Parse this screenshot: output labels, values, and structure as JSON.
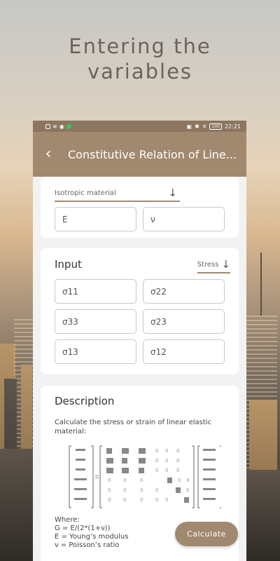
{
  "headline": {
    "line1": "Entering the",
    "line2": "variables"
  },
  "status_bar": {
    "time": "22:21",
    "battery": "100"
  },
  "appbar": {
    "title": "Constitutive Relation of Line..."
  },
  "material": {
    "selected": "Isotropic material",
    "fields": [
      {
        "placeholder": "E"
      },
      {
        "placeholder": "ν"
      }
    ]
  },
  "input": {
    "title": "Input",
    "mode": "Stress",
    "fields": [
      "σ11",
      "σ22",
      "σ33",
      "σ23",
      "σ13",
      "σ12"
    ]
  },
  "description": {
    "title": "Description",
    "text": "Calculate the stress or strain of linear elastic material:",
    "where_lines": [
      "Where:",
      "G = E/(2*(1+ν))",
      "E = Young’s modulus",
      "ν = Poisson’s ratio"
    ]
  },
  "calculate_label": "Calculate"
}
